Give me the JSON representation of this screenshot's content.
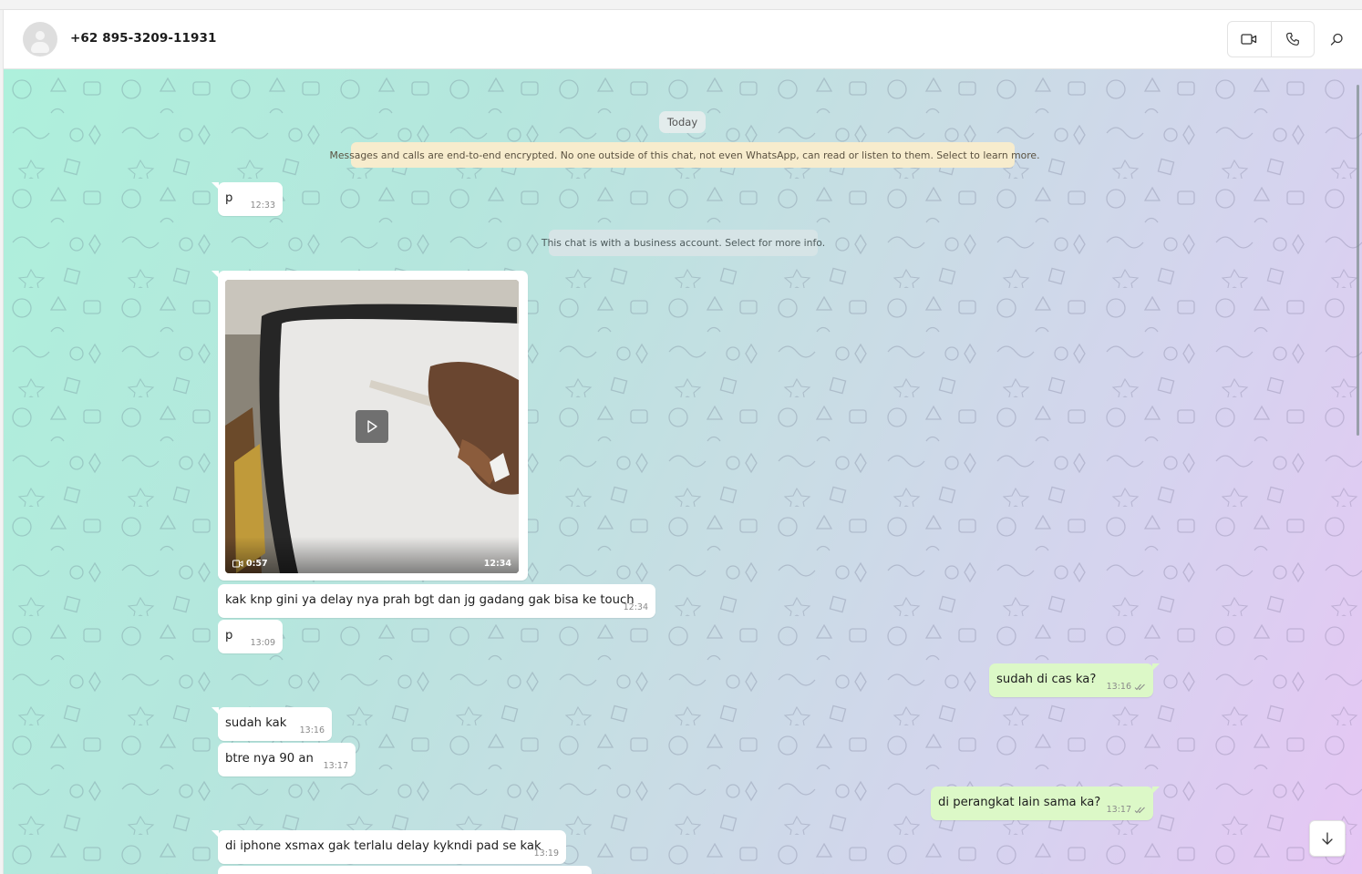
{
  "header": {
    "contact_name": "+62 895-3209-11931",
    "video_call_icon": "video-camera-icon",
    "voice_call_icon": "phone-icon",
    "search_icon": "search-icon"
  },
  "chat": {
    "date_divider": "Today",
    "encryption_notice": "Messages and calls are end-to-end encrypted. No one outside of this chat, not even WhatsApp, can read or listen to them. Select to learn more.",
    "business_notice": "This chat is with a business account. Select for more info.",
    "messages": [
      {
        "direction": "incoming",
        "text": "p",
        "time": "12:33"
      },
      {
        "direction": "incoming",
        "type": "video",
        "duration": "0:57",
        "time": "12:34"
      },
      {
        "direction": "incoming",
        "text": "kak knp gini ya delay nya prah bgt dan jg gadang gak bisa ke touch",
        "time": "12:34"
      },
      {
        "direction": "incoming",
        "text": "p",
        "time": "13:09"
      },
      {
        "direction": "outgoing",
        "text": "sudah di cas ka?",
        "time": "13:16",
        "status": "read"
      },
      {
        "direction": "incoming",
        "text": "sudah kak",
        "time": "13:16"
      },
      {
        "direction": "incoming",
        "text": "btre nya 90 an",
        "time": "13:17"
      },
      {
        "direction": "outgoing",
        "text": "di perangkat lain sama ka?",
        "time": "13:17",
        "status": "read"
      },
      {
        "direction": "incoming",
        "text": "di iphone xsmax gak terlalu delay kykndi pad se kak",
        "time": "13:19"
      }
    ]
  },
  "colors": {
    "incoming_bubble": "#ffffff",
    "outgoing_bubble": "#dcf8c7",
    "encryption_notice_bg": "#f7eccd",
    "read_tick": "#8a8a8a"
  }
}
